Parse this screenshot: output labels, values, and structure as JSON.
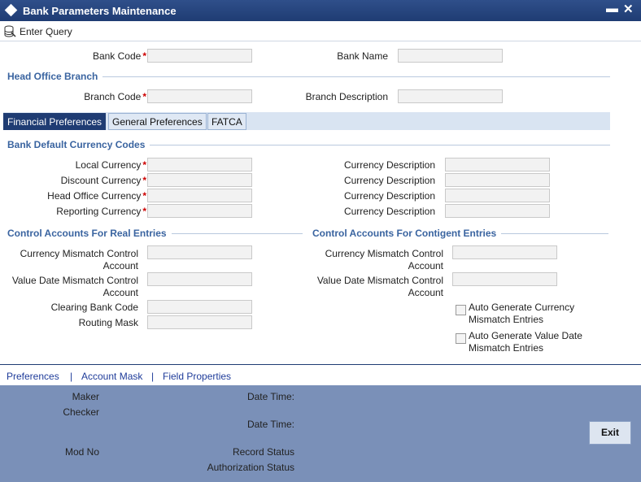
{
  "window": {
    "title": "Bank Parameters Maintenance",
    "minimize": "▬",
    "close": "✕"
  },
  "toolbar": {
    "enter_query": "Enter Query"
  },
  "header": {
    "bank_code_label": "Bank Code",
    "bank_code_value": "",
    "bank_name_label": "Bank Name",
    "bank_name_value": ""
  },
  "head_office": {
    "section_title": "Head Office Branch",
    "branch_code_label": "Branch Code",
    "branch_code_value": "",
    "branch_desc_label": "Branch Description",
    "branch_desc_value": ""
  },
  "tabs": [
    {
      "label": "Financial Preferences",
      "active": true
    },
    {
      "label": "General Preferences",
      "active": false
    },
    {
      "label": "FATCA",
      "active": false
    }
  ],
  "currency": {
    "section_title": "Bank Default Currency Codes",
    "rows": [
      {
        "label": "Local Currency",
        "desc_label": "Currency Description"
      },
      {
        "label": "Discount Currency",
        "desc_label": "Currency Description"
      },
      {
        "label": "Head Office Currency",
        "desc_label": "Currency Description"
      },
      {
        "label": "Reporting Currency",
        "desc_label": "Currency Description"
      }
    ]
  },
  "control_real": {
    "section_title": "Control Accounts For Real Entries",
    "ccy_mismatch_l1": "Currency Mismatch Control",
    "ccy_mismatch_l2": "Account",
    "vd_mismatch_l1": "Value Date Mismatch Control",
    "vd_mismatch_l2": "Account",
    "clearing_bank_code": "Clearing Bank Code",
    "routing_mask": "Routing Mask"
  },
  "control_contingent": {
    "section_title": "Control Accounts For Contigent Entries",
    "ccy_mismatch_l1": "Currency Mismatch Control",
    "ccy_mismatch_l2": "Account",
    "vd_mismatch_l1": "Value Date Mismatch Control",
    "vd_mismatch_l2": "Account",
    "auto_ccy_l1": "Auto Generate Currency",
    "auto_ccy_l2": "Mismatch Entries",
    "auto_vd_l1": "Auto Generate Value Date",
    "auto_vd_l2": "Mismatch Entries"
  },
  "links": {
    "preferences": "Preferences",
    "account_mask": "Account Mask",
    "field_properties": "Field Properties",
    "sep": "|"
  },
  "footer": {
    "maker": "Maker",
    "checker": "Checker",
    "mod_no": "Mod No",
    "date_time": "Date Time:",
    "record_status": "Record Status",
    "auth_status": "Authorization Status",
    "exit": "Exit"
  },
  "required_marker": "*"
}
